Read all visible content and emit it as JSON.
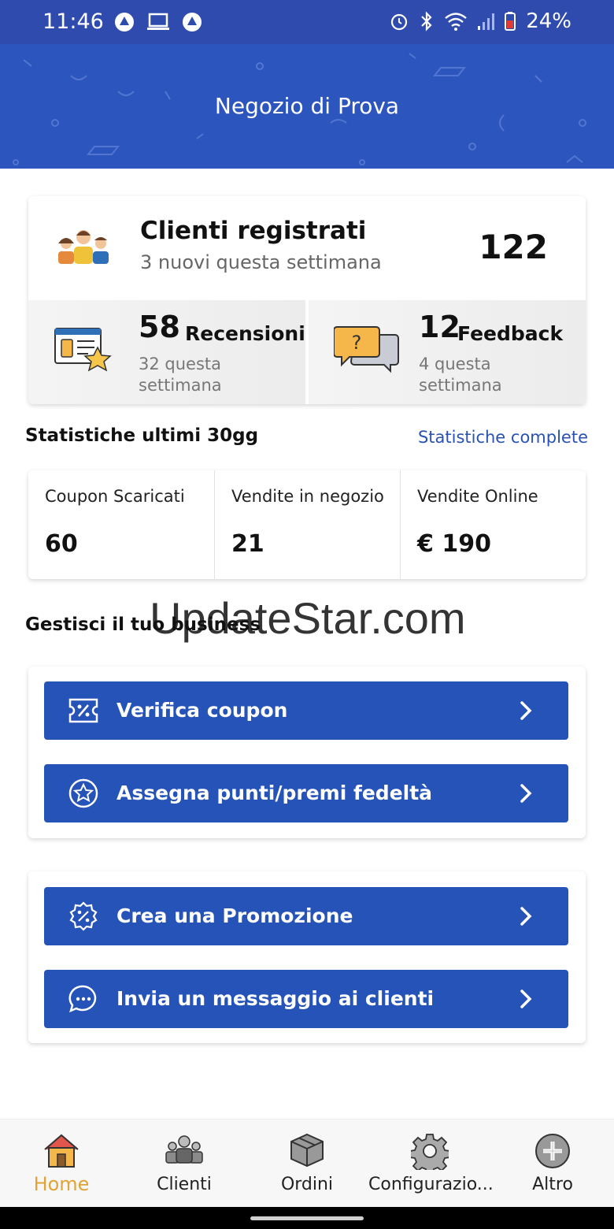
{
  "status_bar": {
    "time": "11:46",
    "battery": "24%"
  },
  "header": {
    "title": "Negozio di Prova"
  },
  "clients": {
    "title": "Clienti registrati",
    "subtitle": "3 nuovi questa settimana",
    "count": "122",
    "reviews": {
      "count": "58",
      "label": "Recensioni",
      "sub": "32 questa settimana"
    },
    "feedback": {
      "count": "12",
      "label": "Feedback",
      "sub": "4 questa settimana"
    }
  },
  "stats": {
    "title": "Statistiche ultimi 30gg",
    "link": "Statistiche complete",
    "items": [
      {
        "label": "Coupon Scaricati",
        "value": "60"
      },
      {
        "label": "Vendite in negozio",
        "value": "21"
      },
      {
        "label": "Vendite Online",
        "value": "€ 190"
      }
    ]
  },
  "manage": {
    "title": "Gestisci il tuo business",
    "watermark": "UpdateStar.com",
    "actions": [
      {
        "label": "Verifica coupon",
        "icon": "coupon-icon"
      },
      {
        "label": "Assegna punti/premi fedeltà",
        "icon": "star-badge-icon"
      },
      {
        "label": "Crea una Promozione",
        "icon": "percent-badge-icon"
      },
      {
        "label": "Invia un messaggio ai clienti",
        "icon": "chat-bubble-icon"
      }
    ]
  },
  "bottom_nav": {
    "items": [
      {
        "label": "Home",
        "icon": "home-icon",
        "active": true
      },
      {
        "label": "Clienti",
        "icon": "clients-icon"
      },
      {
        "label": "Ordini",
        "icon": "box-icon"
      },
      {
        "label": "Configurazio...",
        "icon": "gear-icon"
      },
      {
        "label": "Altro",
        "icon": "plus-circle-icon"
      }
    ]
  },
  "colors": {
    "header": "#2d55be",
    "button": "#2653b8",
    "accent_link": "#2a52b3",
    "nav_active": "#e0a436"
  }
}
